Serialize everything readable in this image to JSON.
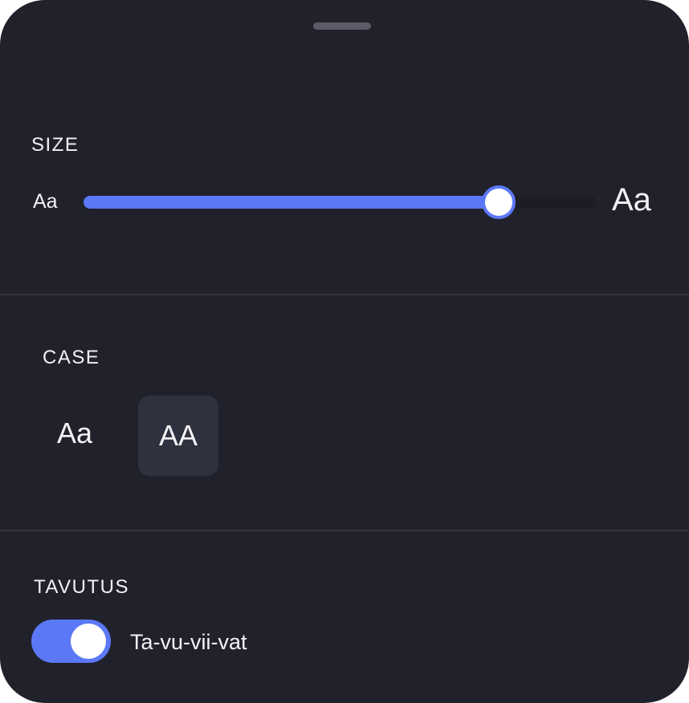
{
  "colors": {
    "sheet_background": "#21212c",
    "accent": "#5b78f7",
    "divider": "#33343f",
    "selected_option_background": "#30313f"
  },
  "size_section": {
    "label": "SIZE",
    "min_label": "Aa",
    "max_label": "Aa",
    "slider_fraction": 0.81
  },
  "case_section": {
    "label": "CASE",
    "options": [
      {
        "label": "Aa",
        "selected": false
      },
      {
        "label": "AA",
        "selected": true
      }
    ]
  },
  "hyphenation_section": {
    "label": "TAVUTUS",
    "toggle_on": true,
    "toggle_text": "Ta-vu-vii-vat"
  }
}
